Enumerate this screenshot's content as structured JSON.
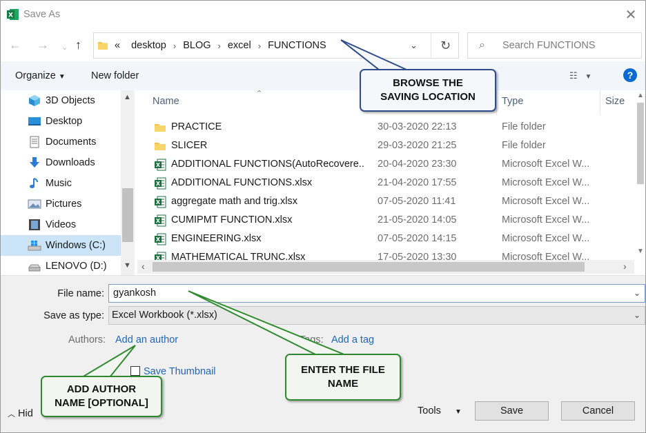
{
  "window": {
    "title": "Save As"
  },
  "address": {
    "crumbs": [
      "«",
      "desktop",
      "BLOG",
      "excel",
      "FUNCTIONS"
    ],
    "separator": "›"
  },
  "search": {
    "placeholder": "Search FUNCTIONS"
  },
  "toolbar": {
    "organize": "Organize",
    "new_folder": "New folder"
  },
  "nav": [
    {
      "label": "3D Objects",
      "icon": "3d-objects-icon"
    },
    {
      "label": "Desktop",
      "icon": "desktop-icon"
    },
    {
      "label": "Documents",
      "icon": "documents-icon"
    },
    {
      "label": "Downloads",
      "icon": "downloads-icon"
    },
    {
      "label": "Music",
      "icon": "music-icon"
    },
    {
      "label": "Pictures",
      "icon": "pictures-icon"
    },
    {
      "label": "Videos",
      "icon": "videos-icon"
    },
    {
      "label": "Windows (C:)",
      "icon": "windows-drive-icon",
      "selected": true
    },
    {
      "label": "LENOVO (D:)",
      "icon": "drive-icon"
    }
  ],
  "columns": {
    "name": "Name",
    "type": "Type",
    "size": "Size"
  },
  "files": [
    {
      "name": "PRACTICE",
      "date": "30-03-2020 22:13",
      "type": "File folder",
      "icon": "folder-icon"
    },
    {
      "name": "SLICER",
      "date": "29-03-2020 21:25",
      "type": "File folder",
      "icon": "folder-icon"
    },
    {
      "name": "ADDITIONAL FUNCTIONS(AutoRecovere...",
      "date": "20-04-2020 23:30",
      "type": "Microsoft Excel W...",
      "icon": "excel-file-icon"
    },
    {
      "name": "ADDITIONAL FUNCTIONS.xlsx",
      "date": "21-04-2020 17:55",
      "type": "Microsoft Excel W...",
      "icon": "excel-file-icon"
    },
    {
      "name": "aggregate math and trig.xlsx",
      "date": "07-05-2020 11:41",
      "type": "Microsoft Excel W...",
      "icon": "excel-file-icon"
    },
    {
      "name": "CUMIPMT FUNCTION.xlsx",
      "date": "21-05-2020 14:05",
      "type": "Microsoft Excel W...",
      "icon": "excel-file-icon"
    },
    {
      "name": "ENGINEERING.xlsx",
      "date": "07-05-2020 14:15",
      "type": "Microsoft Excel W...",
      "icon": "excel-file-icon"
    },
    {
      "name": "MATHEMATICAL TRUNC.xlsx",
      "date": "17-05-2020 13:30",
      "type": "Microsoft Excel W...",
      "icon": "excel-file-icon"
    }
  ],
  "form": {
    "file_name_label": "File name:",
    "file_name_value": "gyankosh",
    "save_type_label": "Save as type:",
    "save_type_value": "Excel Workbook (*.xlsx)",
    "authors_label": "Authors:",
    "authors_link": "Add an author",
    "tags_label": "Tags:",
    "tags_link": "Add a tag",
    "thumbnail_label": "Save Thumbnail"
  },
  "footer": {
    "hide": "Hid",
    "tools": "Tools",
    "save": "Save",
    "cancel": "Cancel"
  },
  "callouts": {
    "browse": [
      "BROWSE THE",
      "SAVING LOCATION"
    ],
    "file_name": [
      "ENTER THE FILE",
      "NAME"
    ],
    "author": [
      "ADD AUTHOR",
      "NAME [OPTIONAL]"
    ]
  },
  "colors": {
    "accent": "#1e66b6",
    "selection": "#cce4f7",
    "callout_blue": "#2f4b8c",
    "callout_green": "#2f8a2f",
    "excel_green": "#1d6f42"
  }
}
